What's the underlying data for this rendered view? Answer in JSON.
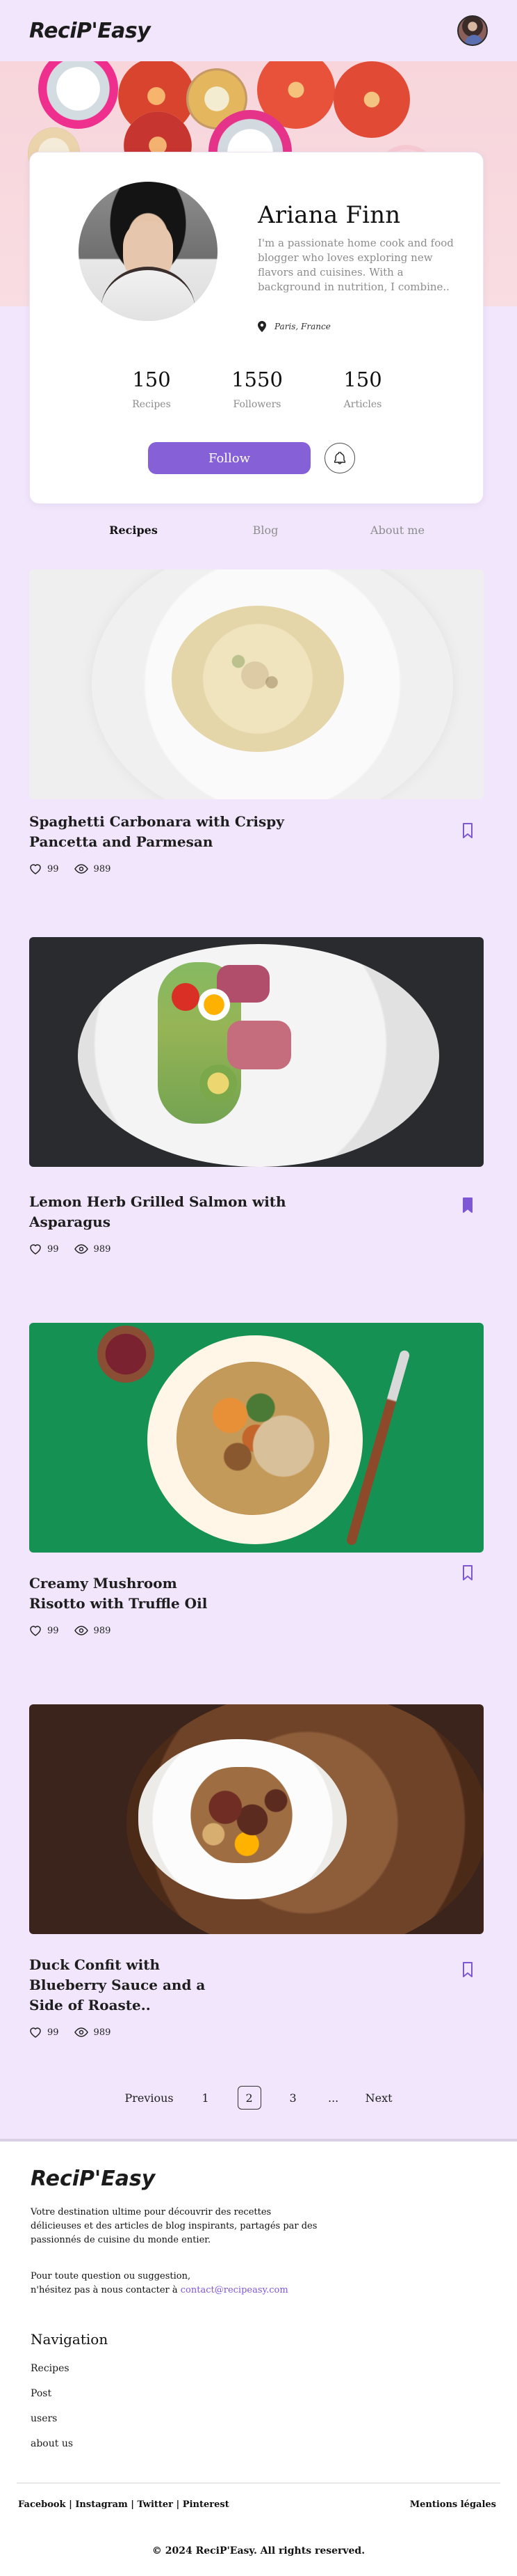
{
  "header": {
    "logo": "ReciP'Easy",
    "avatar_icon": "avatar-icon"
  },
  "profile": {
    "name": "Ariana Finn",
    "bio": "I'm a passionate home cook and food blogger who loves exploring new flavors and cuisines. With a background in nutrition, I combine..",
    "location": "Paris, France",
    "stats": [
      {
        "value": "150",
        "label": "Recipes"
      },
      {
        "value": "1550",
        "label": "Followers"
      },
      {
        "value": "150",
        "label": "Articles"
      }
    ],
    "follow_label": "Follow"
  },
  "tabs": [
    {
      "label": "Recipes",
      "active": true
    },
    {
      "label": "Blog",
      "active": false
    },
    {
      "label": "About me",
      "active": false
    }
  ],
  "recipes": [
    {
      "title": "Spaghetti Carbonara with Crispy Pancetta and Parmesan",
      "likes": "99",
      "views": "989",
      "bookmarked": false
    },
    {
      "title": "Lemon Herb Grilled Salmon with Asparagus",
      "likes": "99",
      "views": "989",
      "bookmarked": true
    },
    {
      "title": "Creamy Mushroom Risotto with Truffle Oil",
      "likes": "99",
      "views": "989",
      "bookmarked": false
    },
    {
      "title": "Duck Confit with Blueberry Sauce and a Side of Roaste..",
      "likes": "99",
      "views": "989",
      "bookmarked": false
    }
  ],
  "pagination": {
    "previous": "Previous",
    "pages": [
      "1",
      "2",
      "3",
      "..."
    ],
    "current": "2",
    "next": "Next"
  },
  "footer": {
    "logo": "ReciP'Easy",
    "description": "Votre destination ultime pour découvrir des recettes délicieuses et des articles de blog inspirants, partagés par des passionnés de cuisine du monde entier.",
    "contact_line1": "Pour toute question ou suggestion,",
    "contact_line2": "n'hésitez pas à nous contacter à ",
    "contact_email": "contact@recipeasy.com",
    "nav_title": "Navigation",
    "nav_items": [
      "Recipes",
      "Post",
      "users",
      "about us"
    ],
    "social": "Facebook | Instagram | Twitter | Pinterest",
    "legal": "Mentions légales",
    "copyright": "© 2024 ReciP'Easy. All rights reserved."
  },
  "colors": {
    "background": "#F1E6FB",
    "accent": "#8560D6",
    "card": "#FFFFFF",
    "muted_text": "#8C8C8C"
  },
  "icons": {
    "location": "location-pin-icon",
    "bell": "bell-icon",
    "heart": "heart-icon",
    "eye": "eye-icon",
    "bookmark": "bookmark-icon"
  }
}
